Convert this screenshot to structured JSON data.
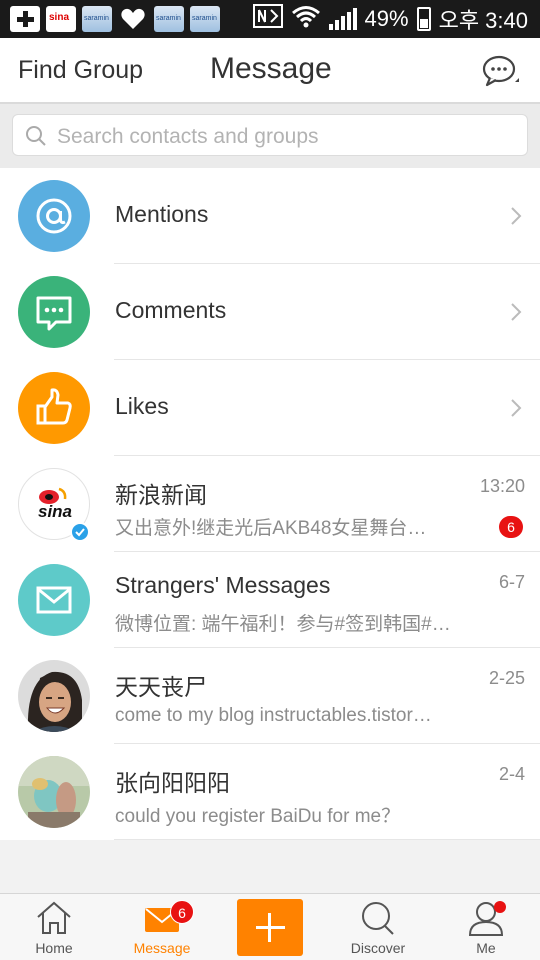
{
  "status_bar": {
    "sina_icon_text": "sina",
    "saramin_icon_text": "saramin",
    "battery": "49%",
    "time": "오후 3:40"
  },
  "header": {
    "left_link": "Find Group",
    "title": "Message"
  },
  "search": {
    "placeholder": "Search contacts and groups"
  },
  "list": {
    "items": [
      {
        "type": "nav",
        "label": "Mentions",
        "icon": "at-icon",
        "color": "#5aaee0"
      },
      {
        "type": "nav",
        "label": "Comments",
        "icon": "comment-icon",
        "color": "#3ab37a"
      },
      {
        "type": "nav",
        "label": "Likes",
        "icon": "thumbs-up-icon",
        "color": "#ff9900"
      },
      {
        "type": "chat",
        "name": "新浪新闻",
        "preview": "又出意外!继走光后AKB48女星舞台…",
        "time": "13:20",
        "unread": "6",
        "avatar_text": "sina"
      },
      {
        "type": "chat",
        "name": "Strangers' Messages",
        "preview": "微博位置: 端午福利！参与#签到韩国#…",
        "time": "6-7",
        "icon": "envelope-icon",
        "color": "#5ecac9"
      },
      {
        "type": "chat",
        "name": "天天丧尸",
        "preview": "come to my blog instructables.tistor…",
        "time": "2-25"
      },
      {
        "type": "chat",
        "name": "张向阳阳阳",
        "preview": "could you register BaiDu for me？",
        "time": "2-4"
      }
    ]
  },
  "tabbar": {
    "tabs": [
      {
        "label": "Home",
        "icon": "home-icon"
      },
      {
        "label": "Message",
        "icon": "envelope-icon",
        "badge": "6",
        "active": true
      },
      {
        "label": "",
        "icon": "plus-icon"
      },
      {
        "label": "Discover",
        "icon": "search-icon"
      },
      {
        "label": "Me",
        "icon": "person-icon",
        "dot": true
      }
    ]
  },
  "colors": {
    "accent": "#ff8200",
    "badge": "#e81212"
  }
}
